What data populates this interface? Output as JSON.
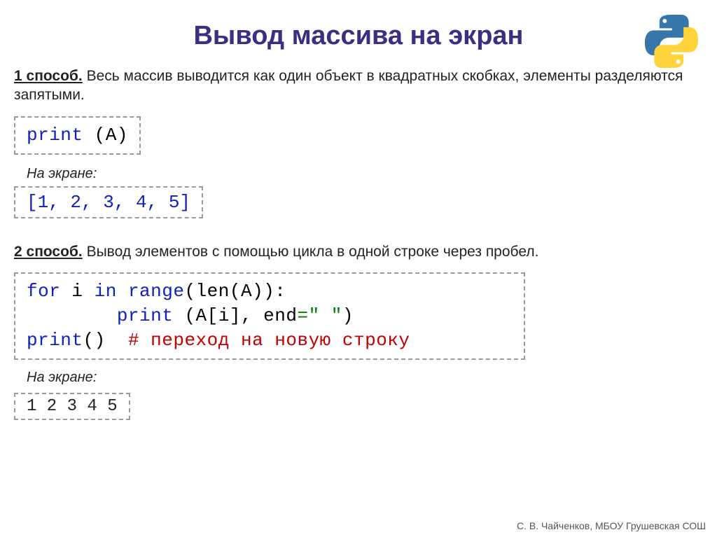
{
  "title": "Вывод массива на экран",
  "method1": {
    "label": "1 способ.",
    "text": " Весь массив выводится как один объект в квадратных скобках, элементы разделяются запятыми.",
    "code_print": "print",
    "code_arg": " (A)",
    "screen_label": "На экране:",
    "output": "[1, 2, 3, 4, 5]"
  },
  "method2": {
    "label": "2 способ.",
    "text": " Вывод элементов с помощью цикла в одной строке через пробел.",
    "code": {
      "part_for": "for",
      "part_i": " i ",
      "part_in": "in",
      "part_range": " range",
      "part_len": "(len(A)):",
      "part_indent1": "        ",
      "part_print1": "print",
      "part_body1a": " (A[i], ",
      "part_end_kw": "end",
      "part_end_val": "=\" \"",
      "part_body1b": ")",
      "part_print2": "print",
      "part_body2": "()  ",
      "part_comment": "# переход на новую строку"
    },
    "screen_label": "На экране:",
    "output": "1 2 3 4 5"
  },
  "footer": "С. В. Чайченков, МБОУ Грушевская СОШ"
}
